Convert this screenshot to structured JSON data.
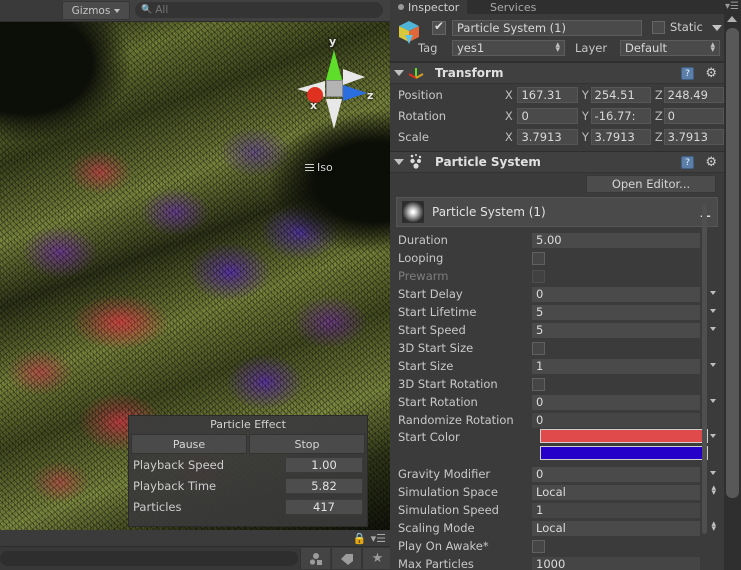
{
  "scene": {
    "toolbar": {
      "gizmos_label": "Gizmos",
      "search_placeholder": "All",
      "search_icon": "search-icon",
      "menu_icon": "panel-menu-icon"
    },
    "gizmo": {
      "x_label": "x",
      "y_label": "y",
      "z_label": "z",
      "x_color": "#e03020",
      "y_color": "#5ede2a",
      "z_color": "#2a6ee0"
    },
    "view_mode_label": "Iso",
    "particle_effect": {
      "title": "Particle Effect",
      "pause_label": "Pause",
      "stop_label": "Stop",
      "rows": [
        {
          "label": "Playback Speed",
          "value": "1.00"
        },
        {
          "label": "Playback Time",
          "value": "5.82"
        },
        {
          "label": "Particles",
          "value": "417"
        }
      ]
    },
    "bottom": {
      "lock_icon": "lock-icon",
      "menu_icon": "hamburger-menu-icon",
      "search_placeholder": "",
      "buttons": [
        {
          "icon": "prefab-icon"
        },
        {
          "icon": "tag-label-icon"
        },
        {
          "icon": "favorite-star-icon"
        }
      ]
    }
  },
  "inspector": {
    "tabs": [
      {
        "label": "Inspector",
        "active": true,
        "icon": "inspector-icon"
      },
      {
        "label": "Services",
        "active": false,
        "icon": "services-icon"
      }
    ],
    "game_object": {
      "icon": "gameobject-cube-icon",
      "enabled": true,
      "name": "Particle System (1)",
      "static_label": "Static",
      "static_checked": false,
      "tag_label": "Tag",
      "tag_value": "yes1",
      "layer_label": "Layer",
      "layer_value": "Default"
    },
    "transform": {
      "title": "Transform",
      "icon": "transform-axis-icon",
      "help_icon": "help-icon",
      "gear_icon": "gear-icon",
      "rows": [
        {
          "label": "Position",
          "x": "167.31",
          "y": "254.51",
          "z": "248.49"
        },
        {
          "label": "Rotation",
          "x": "0",
          "y": "-16.77:",
          "z": "0"
        },
        {
          "label": "Scale",
          "x": "3.7913",
          "y": "3.7913",
          "z": "3.7913"
        }
      ],
      "axis_x": "X",
      "axis_y": "Y",
      "axis_z": "Z"
    },
    "particle_system": {
      "title": "Particle System",
      "icon": "particle-system-icon",
      "help_icon": "help-icon",
      "gear_icon": "gear-icon",
      "open_editor_label": "Open Editor...",
      "module_name": "Particle System (1)",
      "module_thumb_icon": "particle-thumbnail-icon",
      "add_module_icon": "plus-icon",
      "properties": [
        {
          "label": "Duration",
          "type": "text",
          "value": "5.00"
        },
        {
          "label": "Looping",
          "type": "checkbox",
          "value": false
        },
        {
          "label": "Prewarm",
          "type": "checkbox",
          "value": false,
          "disabled": true
        },
        {
          "label": "Start Delay",
          "type": "dropdown",
          "value": "0"
        },
        {
          "label": "Start Lifetime",
          "type": "dropdown",
          "value": "5"
        },
        {
          "label": "Start Speed",
          "type": "dropdown",
          "value": "5"
        },
        {
          "label": "3D Start Size",
          "type": "checkbox",
          "value": false
        },
        {
          "label": "Start Size",
          "type": "dropdown",
          "value": "1"
        },
        {
          "label": "3D Start Rotation",
          "type": "checkbox",
          "value": false
        },
        {
          "label": "Start Rotation",
          "type": "dropdown",
          "value": "0"
        },
        {
          "label": "Randomize Rotation",
          "type": "text",
          "value": "0"
        }
      ],
      "start_color": {
        "label": "Start Color",
        "type": "gradient",
        "top_color": "#e04a4a",
        "bottom_color": "#2400c8"
      },
      "properties_after": [
        {
          "label": "Gravity Modifier",
          "type": "dropdown",
          "value": "0"
        },
        {
          "label": "Simulation Space",
          "type": "select",
          "value": "Local"
        },
        {
          "label": "Simulation Speed",
          "type": "text",
          "value": "1"
        },
        {
          "label": "Scaling Mode",
          "type": "select",
          "value": "Local"
        },
        {
          "label": "Play On Awake*",
          "type": "checkbox",
          "value": false
        },
        {
          "label": "Max Particles",
          "type": "text",
          "value": "1000"
        }
      ]
    }
  },
  "colors": {
    "panel_bg": "#3b3b3b",
    "header_bg": "#404040",
    "field_bg": "#4a4a4a",
    "text": "#c8c8c8"
  }
}
